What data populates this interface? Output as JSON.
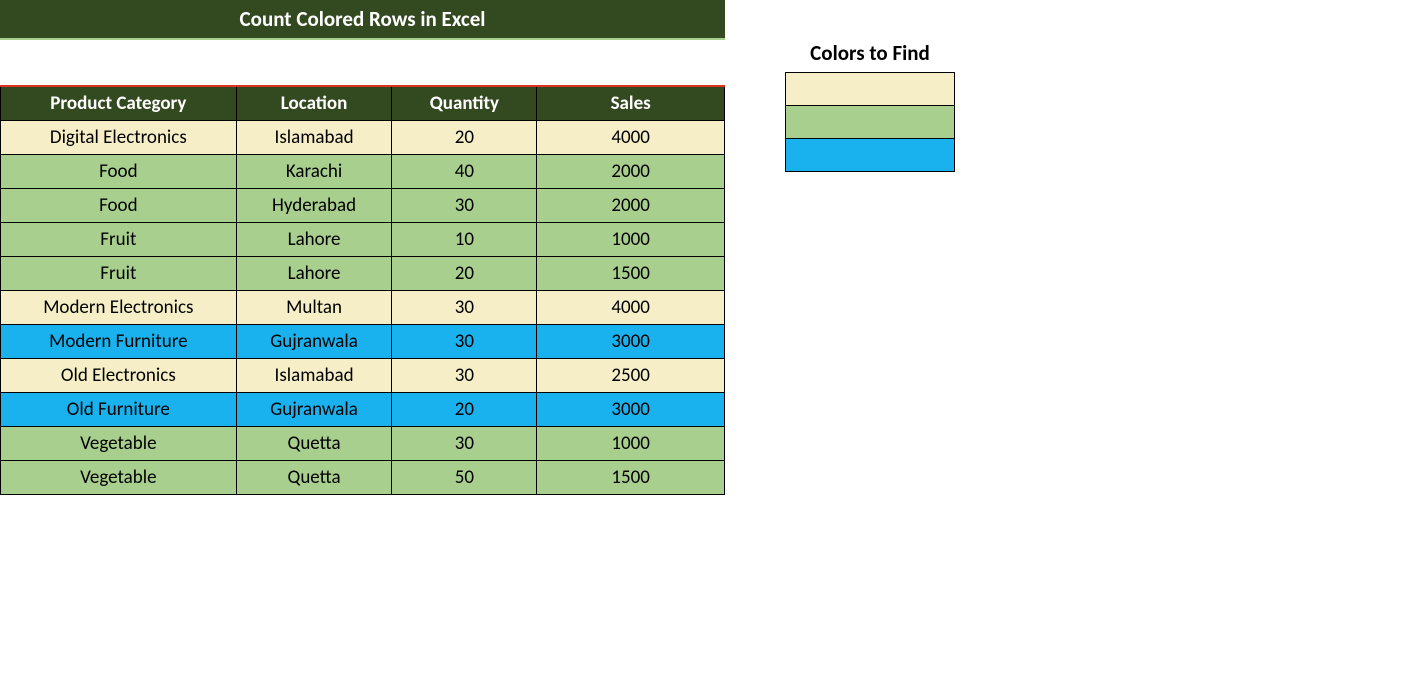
{
  "title": "Count Colored Rows in Excel",
  "legendTitle": "Colors to Find",
  "colors": {
    "cream": "#f5eec6",
    "green": "#a8cf8e",
    "blue": "#1ab2ee",
    "headerBg": "#33491f"
  },
  "headers": {
    "product": "Product Category",
    "location": "Location",
    "quantity": "Quantity",
    "sales": "Sales"
  },
  "rows": [
    {
      "product": "Digital Electronics",
      "location": "Islamabad",
      "quantity": "20",
      "sales": "4000",
      "color": "cream"
    },
    {
      "product": "Food",
      "location": "Karachi",
      "quantity": "40",
      "sales": "2000",
      "color": "green"
    },
    {
      "product": "Food",
      "location": "Hyderabad",
      "quantity": "30",
      "sales": "2000",
      "color": "green"
    },
    {
      "product": "Fruit",
      "location": "Lahore",
      "quantity": "10",
      "sales": "1000",
      "color": "green"
    },
    {
      "product": "Fruit",
      "location": "Lahore",
      "quantity": "20",
      "sales": "1500",
      "color": "green"
    },
    {
      "product": "Modern Electronics",
      "location": "Multan",
      "quantity": "30",
      "sales": "4000",
      "color": "cream"
    },
    {
      "product": "Modern Furniture",
      "location": "Gujranwala",
      "quantity": "30",
      "sales": "3000",
      "color": "blue"
    },
    {
      "product": "Old Electronics",
      "location": "Islamabad",
      "quantity": "30",
      "sales": "2500",
      "color": "cream"
    },
    {
      "product": "Old Furniture",
      "location": "Gujranwala",
      "quantity": "20",
      "sales": "3000",
      "color": "blue"
    },
    {
      "product": "Vegetable",
      "location": "Quetta",
      "quantity": "30",
      "sales": "1000",
      "color": "green"
    },
    {
      "product": "Vegetable",
      "location": "Quetta",
      "quantity": "50",
      "sales": "1500",
      "color": "green"
    }
  ],
  "legendSwatches": [
    "cream",
    "green",
    "blue"
  ]
}
